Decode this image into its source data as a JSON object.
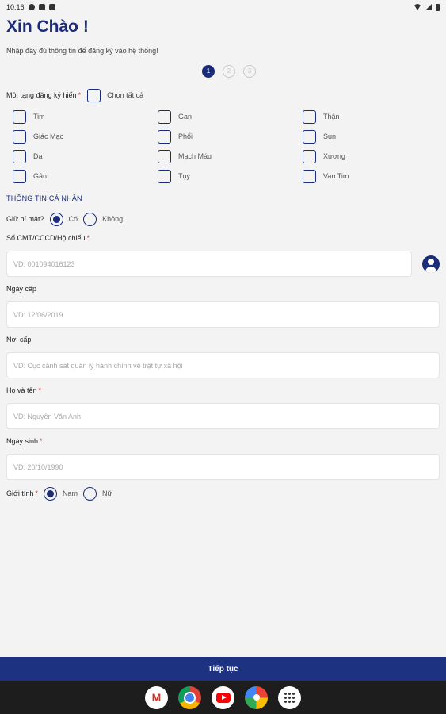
{
  "status_bar": {
    "time": "10:16"
  },
  "header": {
    "title": "Xin Chào !",
    "subtitle": "Nhập đầy đủ thông tin để đăng ký vào hệ thống!"
  },
  "stepper": {
    "steps": [
      "1",
      "2",
      "3"
    ],
    "active_step": 1
  },
  "organs": {
    "label": "Mô, tạng đăng ký hiến",
    "required_mark": "*",
    "select_all_label": "Chọn tất cả",
    "items": [
      "Tim",
      "Gan",
      "Thận",
      "Giác Mạc",
      "Phổi",
      "Sụn",
      "Da",
      "Mạch Máu",
      "Xương",
      "Gân",
      "Tụy",
      "Van Tim"
    ]
  },
  "personal_info": {
    "section_title": "THÔNG TIN CÁ NHÂN",
    "secret": {
      "label": "Giữ bí mật?",
      "options": [
        "Có",
        "Không"
      ],
      "selected": "Có"
    },
    "id_number": {
      "label": "Số CMT/CCCD/Hộ chiếu",
      "required_mark": "*",
      "placeholder": "VD: 001094016123"
    },
    "issue_date": {
      "label": "Ngày cấp",
      "placeholder": "VD: 12/06/2019"
    },
    "issue_place": {
      "label": "Nơi cấp",
      "placeholder": "VD: Cục cảnh sát quản lý hành chính về trật tự xã hội"
    },
    "full_name": {
      "label": "Họ và tên",
      "required_mark": "*",
      "placeholder": "VD: Nguyễn Văn Anh"
    },
    "birth_date": {
      "label": "Ngày sinh",
      "required_mark": "*",
      "placeholder": "VD: 20/10/1990"
    },
    "gender": {
      "label": "Giới tính",
      "required_mark": "*",
      "options": [
        "Nam",
        "Nữ"
      ],
      "selected": "Nam"
    }
  },
  "footer": {
    "continue_label": "Tiếp tục"
  },
  "dock": {
    "apps": [
      "gmail-icon",
      "chrome-icon",
      "youtube-icon",
      "photos-icon",
      "app-drawer-icon"
    ]
  },
  "colors": {
    "primary": "#1a2c7a",
    "button": "#1e3282",
    "required": "#d32f2f",
    "background": "#f3f3f3"
  }
}
